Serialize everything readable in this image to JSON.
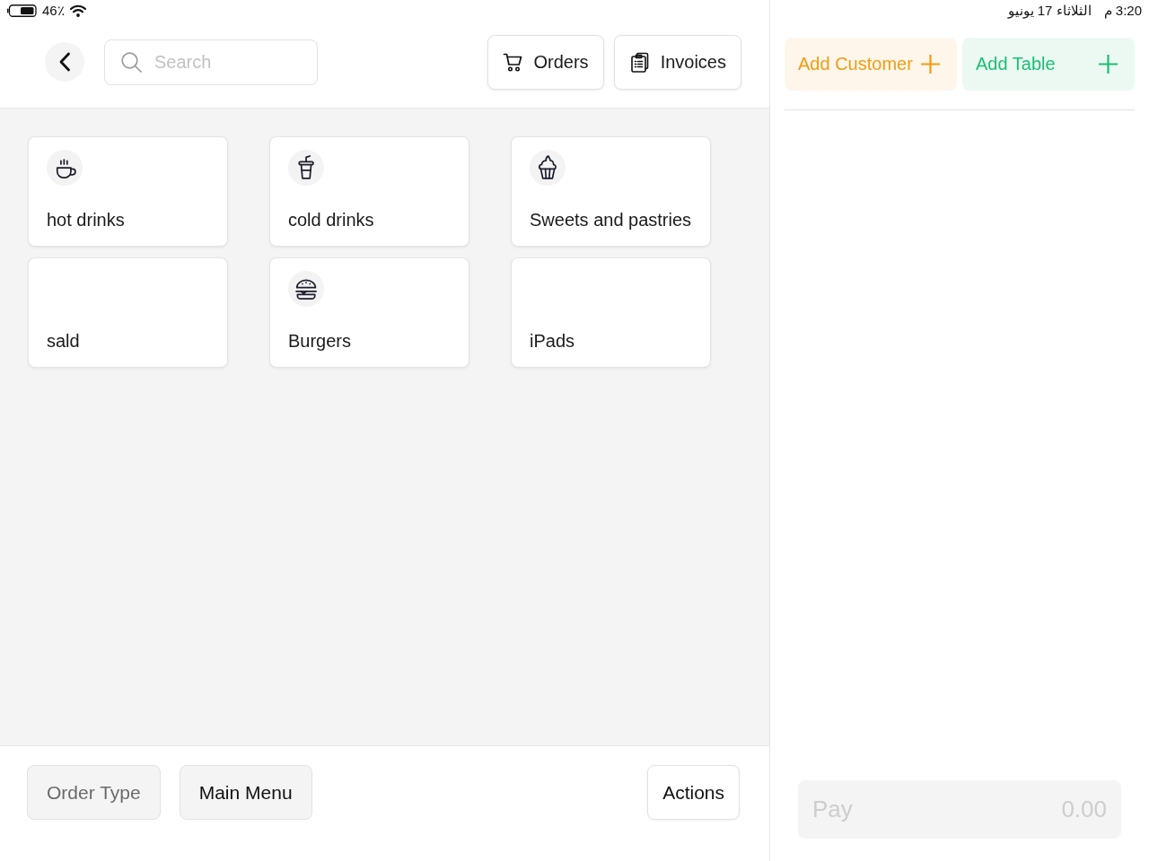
{
  "status_bar": {
    "battery": "46٪",
    "time": "3:20 م",
    "date": "الثلاثاء 17 يونيو"
  },
  "header": {
    "search": {
      "placeholder": "Search"
    },
    "buttons": [
      {
        "label": "Orders",
        "kind": "cart"
      },
      {
        "label": "Invoices",
        "kind": "documents"
      }
    ]
  },
  "categories": [
    {
      "label": "hot drinks",
      "kind": "cup"
    },
    {
      "label": "cold drinks",
      "kind": "tumbler"
    },
    {
      "label": "Sweets and pastries",
      "kind": "cupcake"
    },
    {
      "label": "sald",
      "kind": "plain"
    },
    {
      "label": "Burgers",
      "kind": "burger"
    },
    {
      "label": "iPads",
      "kind": "plain"
    }
  ],
  "footer": {
    "buttons": [
      {
        "label": "Order Type",
        "kind": "filled",
        "disabled": true
      },
      {
        "label": "Main Menu",
        "kind": "filled",
        "disabled": false
      },
      {
        "label": "Actions",
        "kind": "outline",
        "disabled": false
      }
    ]
  },
  "order_panel": {
    "buttons": [
      {
        "label": "Add Customer",
        "color": "#f39c12"
      },
      {
        "label": "Add Table",
        "color": "#1dbf73"
      }
    ],
    "pay": {
      "label": "Pay",
      "amount": "0.00",
      "disabled": true
    }
  }
}
